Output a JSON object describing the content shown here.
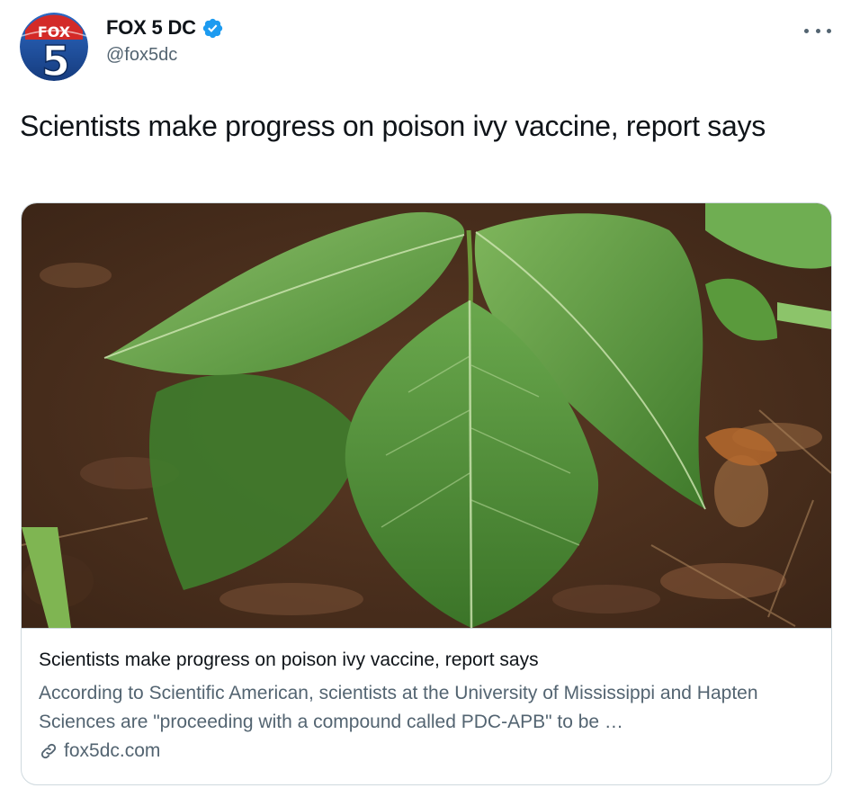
{
  "account": {
    "display_name": "FOX 5 DC",
    "handle": "@fox5dc",
    "logo_text_top": "FOX",
    "logo_text_number": "5",
    "verified_icon": "verified-badge-icon"
  },
  "more_icon": "more-options-icon",
  "tweet": {
    "text": "Scientists make progress on poison ivy vaccine, report says"
  },
  "card": {
    "image_subject": "poison ivy leaves",
    "title": "Scientists make progress on poison ivy vaccine, report says",
    "description": "According to Scientific American, scientists at the University of Mississippi and Hapten Sciences are \"proceeding with a compound called PDC-APB\" to be …",
    "link_icon": "link-icon",
    "domain": "fox5dc.com"
  },
  "colors": {
    "text_primary": "#0f1419",
    "text_secondary": "#536471",
    "verified_blue": "#1d9bf0",
    "border": "#cfd9de",
    "logo_red": "#d32a28",
    "logo_blue": "#1d4f9c"
  }
}
